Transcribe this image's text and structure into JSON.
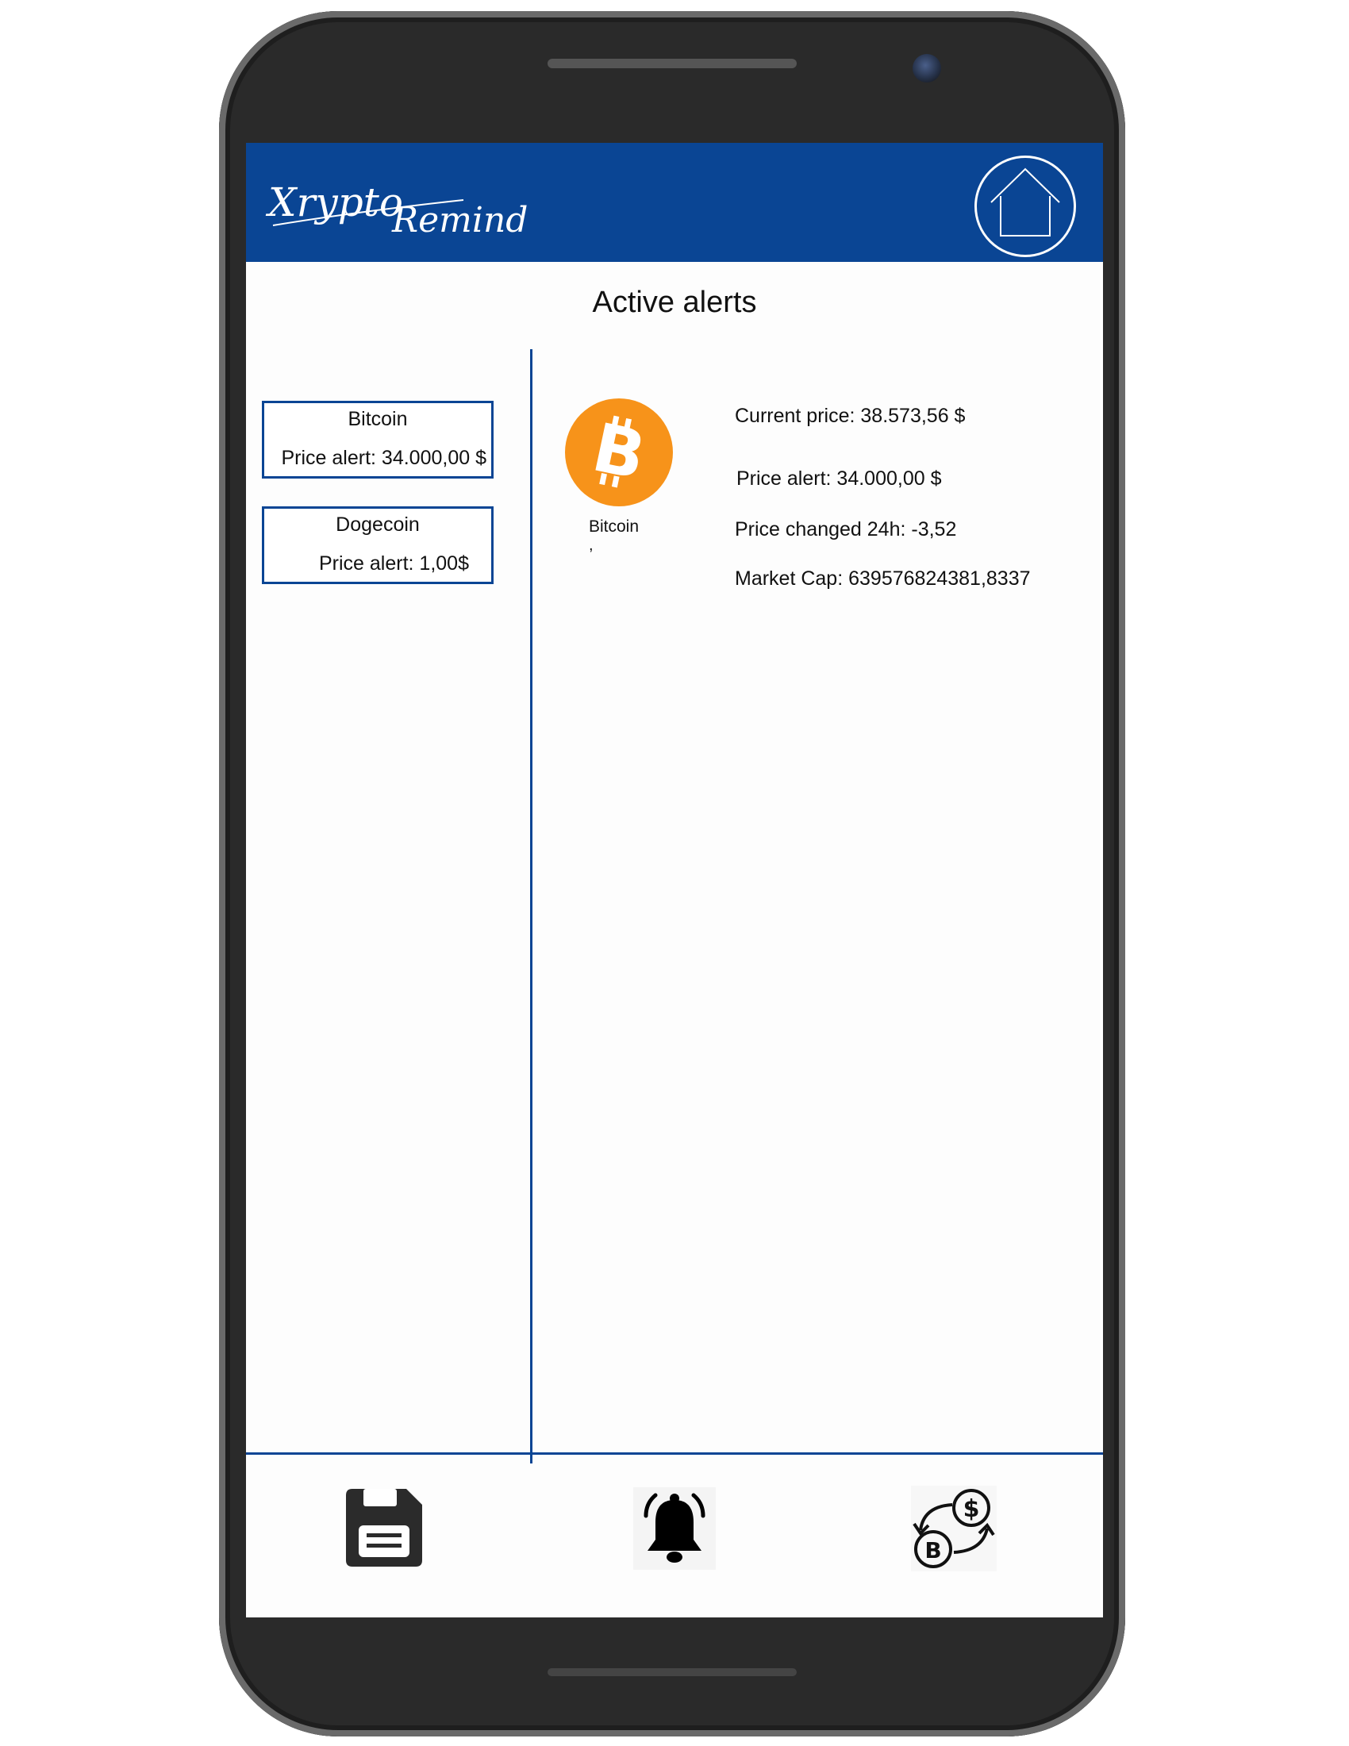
{
  "header": {
    "logo_text": "XryptoRemind",
    "brand_color": "#0a4594",
    "home_icon": "home-icon"
  },
  "page": {
    "title": "Active alerts"
  },
  "alerts": [
    {
      "name": "Bitcoin",
      "price_alert": "Price alert: 34.000,00 $"
    },
    {
      "name": "Dogecoin",
      "price_alert": "Price alert: 1,00$"
    }
  ],
  "detail": {
    "coin_icon": "bitcoin-icon",
    "coin_icon_color": "#f7931a",
    "coin_name": "Bitcoin",
    "coin_mark": ",",
    "current_price": "Current price: 38.573,56 $",
    "price_alert": "Price alert: 34.000,00 $",
    "price_changed": "Price changed 24h: -3,52",
    "market_cap": "Market Cap: 639576824381,8337"
  },
  "bottom_nav": [
    {
      "icon": "save-icon"
    },
    {
      "icon": "bell-icon"
    },
    {
      "icon": "currency-exchange-icon"
    }
  ]
}
